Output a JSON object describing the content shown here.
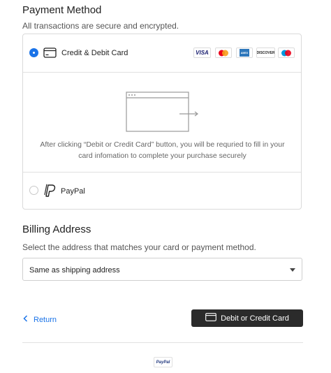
{
  "payment": {
    "title": "Payment Method",
    "subtitle": "All transactions are secure and encrypted.",
    "card_option": {
      "label": "Credit & Debit Card",
      "selected": true,
      "brands": [
        "VISA",
        "mastercard",
        "AMEX",
        "DISCOVER",
        "maestro"
      ],
      "info_text": "After clicking “Debit or Credit Card” button, you will be requried to fill in your card infomation to complete your purchase securely"
    },
    "paypal_option": {
      "label": "PayPal",
      "selected": false
    }
  },
  "billing": {
    "title": "Billing Address",
    "subtitle": "Select the address that matches your card or payment method.",
    "selected_value": "Same as shipping address"
  },
  "footer": {
    "return_label": "Return",
    "submit_label": "Debit or Credit Card",
    "powered_by": "PayPal"
  },
  "colors": {
    "accent": "#1a73e8",
    "button": "#2b2b2b",
    "border": "#dadada"
  }
}
